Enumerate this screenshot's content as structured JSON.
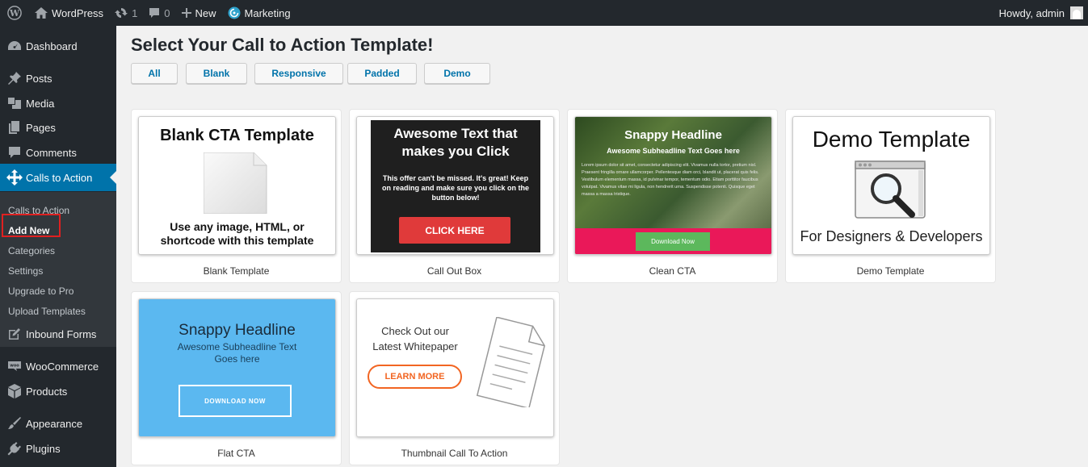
{
  "adminbar": {
    "site_name": "WordPress",
    "updates_count": "1",
    "comments_count": "0",
    "new_label": "New",
    "marketing_label": "Marketing",
    "howdy": "Howdy, admin"
  },
  "sidebar": {
    "items": [
      {
        "label": "Dashboard",
        "icon": "dashboard-icon"
      },
      {
        "label": "Posts",
        "icon": "pin-icon"
      },
      {
        "label": "Media",
        "icon": "media-icon"
      },
      {
        "label": "Pages",
        "icon": "pages-icon"
      },
      {
        "label": "Comments",
        "icon": "comment-icon"
      },
      {
        "label": "Calls to Action",
        "icon": "move-icon"
      },
      {
        "label": "Inbound Forms",
        "icon": "edit-icon"
      },
      {
        "label": "WooCommerce",
        "icon": "woo-icon"
      },
      {
        "label": "Products",
        "icon": "box-icon"
      },
      {
        "label": "Appearance",
        "icon": "brush-icon"
      },
      {
        "label": "Plugins",
        "icon": "plug-icon"
      }
    ],
    "submenu": [
      "Calls to Action",
      "Add New",
      "Categories",
      "Settings",
      "Upgrade to Pro",
      "Upload Templates"
    ]
  },
  "main": {
    "title": "Select Your Call to Action Template!",
    "filters": [
      "All",
      "Blank",
      "Responsive",
      "Padded",
      "Demo"
    ]
  },
  "templates": {
    "blank": {
      "label": "Blank Template",
      "heading": "Blank CTA Template",
      "text_line1": "Use any image, HTML, or",
      "text_line2": "shortcode with this template"
    },
    "callout": {
      "label": "Call Out Box",
      "heading_line1": "Awesome Text that",
      "heading_line2": "makes you Click",
      "body": "This offer can't be missed. It's great! Keep on reading and make sure you click on the button below!",
      "button": "CLICK HERE"
    },
    "clean": {
      "label": "Clean CTA",
      "heading": "Snappy Headline",
      "subheading": "Awesome Subheadline Text Goes here",
      "body": "Lorem ipsum dolor sit amet, consectetur adipiscing elit. Vivamus nulla tortor, pretium nisl. Praesent fringilla ornare ullamcorper. Pellentesque diam orci, blandit ut, placerat quis felis. Vestibulum elementum massa, id pulvinar tempor, tementum odio. Etiam porttitor faucibus volutpat. Vivamus vitae mi ligula, non hendrerit urna. Suspendisse potenti. Quisque eget massa a massa tristique.",
      "button": "Download Now"
    },
    "demo": {
      "label": "Demo Template",
      "heading": "Demo Template",
      "subheading": "For Designers & Developers"
    },
    "flat": {
      "label": "Flat CTA",
      "heading": "Snappy Headline",
      "sub_line1": "Awesome Subheadline Text",
      "sub_line2": "Goes here",
      "button": "DOWNLOAD NOW"
    },
    "thumbnail": {
      "label": "Thumbnail Call To Action",
      "heading_line1": "Check Out our",
      "heading_line2": "Latest Whitepaper",
      "button": "LEARN MORE"
    }
  },
  "colors": {
    "adminbar_bg": "#23282d",
    "accent": "#0073aa",
    "highlight_border": "#e02020",
    "callout_button": "#e03a3a",
    "clean_bar": "#ea1859",
    "clean_button": "#5cb85c",
    "flat_bg": "#5bb8f0",
    "thumb_button": "#f26522"
  }
}
